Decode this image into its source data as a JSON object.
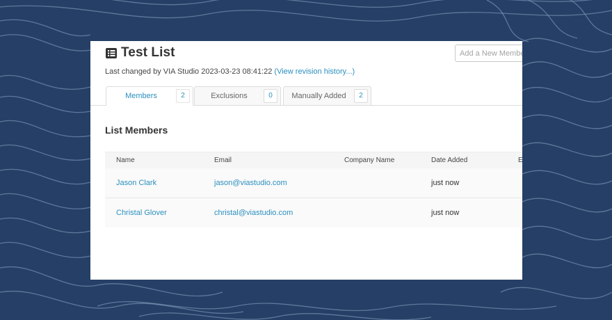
{
  "page": {
    "title": "Test List",
    "add_member_placeholder": "Add a New Member",
    "last_changed_prefix": "Last changed by VIA Studio 2023-03-23 08:41:22",
    "revision_link": "(View revision history...)",
    "section_title": "List Members"
  },
  "tabs": [
    {
      "label": "Members",
      "count": "2",
      "active": true
    },
    {
      "label": "Exclusions",
      "count": "0",
      "active": false
    },
    {
      "label": "Manually Added",
      "count": "2",
      "active": false
    }
  ],
  "table": {
    "columns": [
      "Name",
      "Email",
      "Company Name",
      "Date Added",
      "E"
    ],
    "rows": [
      {
        "name": "Jason Clark",
        "email": "jason@viastudio.com",
        "company": "",
        "date_added": "just now"
      },
      {
        "name": "Christal Glover",
        "email": "christal@viastudio.com",
        "company": "",
        "date_added": "just now"
      }
    ]
  },
  "colors": {
    "background": "#253f66",
    "accent": "#2a8fbf"
  },
  "icons": {
    "title_icon": "list-icon"
  }
}
